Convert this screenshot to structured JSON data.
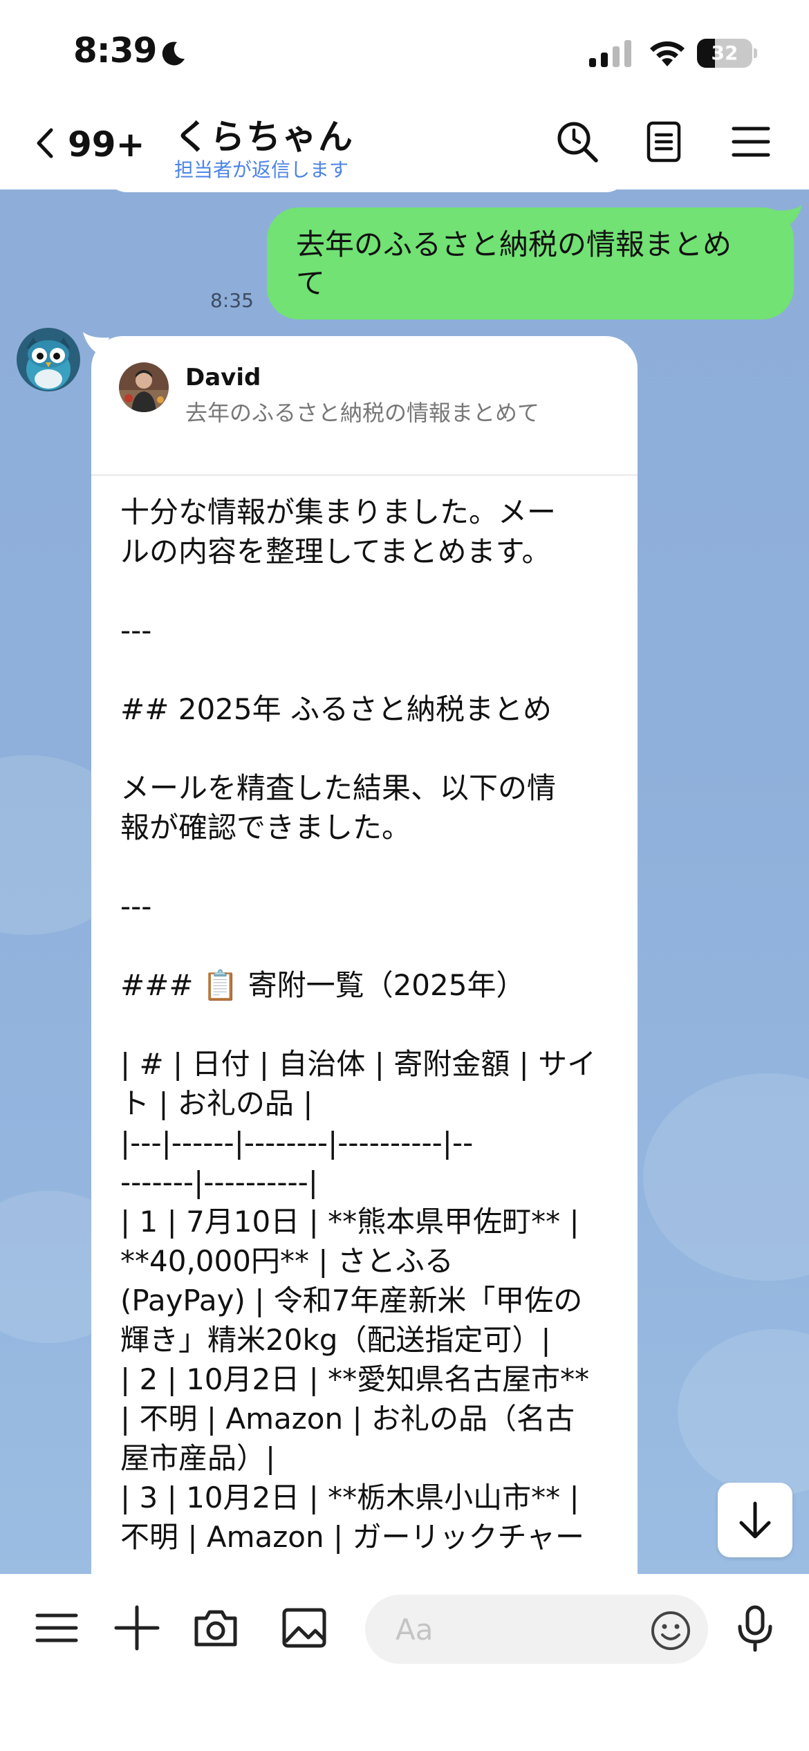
{
  "status_bar": {
    "time": "8:39",
    "battery_level": "32",
    "icons": [
      "moon-icon",
      "cellular-signal-icon",
      "wifi-icon",
      "battery-icon"
    ]
  },
  "header": {
    "back_count": "99+",
    "title": "くらちゃん",
    "subtitle": "担当者が返信します",
    "icons": [
      "back-chevron-icon",
      "search-icon",
      "notes-icon",
      "menu-icon"
    ]
  },
  "sent_message": {
    "lines": [
      "去年のふるさと納税の情報まとめ",
      "て"
    ],
    "time": "8:35"
  },
  "received_message": {
    "reply_name": "David",
    "reply_text": "去年のふるさと納税の情報まとめて",
    "lines": [
      "十分な情報が集まりました。メー",
      "ルの内容を整理してまとめます。",
      "",
      "---",
      "",
      "## 2025年 ふるさと納税まとめ",
      "",
      "メールを精査した結果、以下の情",
      "報が確認できました。",
      "",
      "---",
      "",
      "### 📋 寄附一覧（2025年）",
      "",
      "| # | 日付 | 自治体 | 寄附金額 | サイ",
      "ト | お礼の品 |",
      "|---|------|--------|----------|--",
      "-------|----------|",
      "| 1 | 7月10日 | **熊本県甲佐町** |",
      "**40,000円** | さとふる",
      "(PayPay) | 令和7年産新米「甲佐の",
      "輝き」精米20kg（配送指定可）|",
      "| 2 | 10月2日 | **愛知県名古屋市**",
      "| 不明 | Amazon | お礼の品（名古",
      "屋市産品）|",
      "| 3 | 10月2日 | **栃木県小山市** |",
      "不明 | Amazon | ガーリックチャー"
    ]
  },
  "input_bar": {
    "placeholder": "Aa",
    "icons": [
      "menu-icon",
      "plus-icon",
      "camera-icon",
      "image-icon",
      "emoji-icon",
      "microphone-icon"
    ]
  },
  "colors": {
    "sent_bubble": "#71e273",
    "chat_background": "#8fb0da",
    "subtitle_blue": "#4b84e6"
  }
}
